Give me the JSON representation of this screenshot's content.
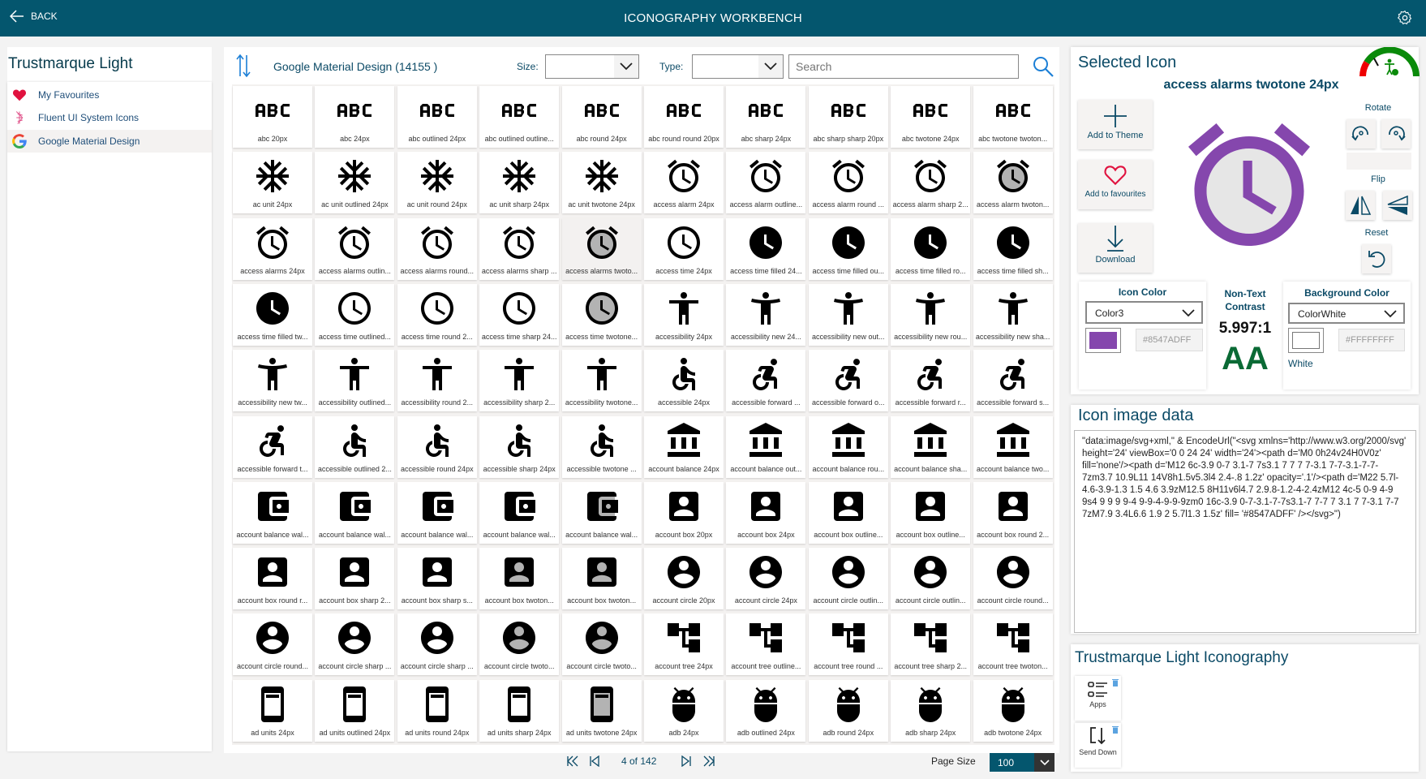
{
  "header": {
    "back_label": "BACK",
    "title": "ICONOGRAPHY WORKBENCH",
    "settings_icon": "gear-icon"
  },
  "left": {
    "title": "Trustmarque Light",
    "libraries": [
      {
        "label": "My Favourites",
        "icon": "heart-icon"
      },
      {
        "label": "Fluent UI System Icons",
        "icon": "fluent-logo-icon"
      },
      {
        "label": "Google Material Design",
        "icon": "google-logo-icon",
        "selected": true
      }
    ]
  },
  "toolbar": {
    "library_title": "Google Material Design (14155 )",
    "size_label": "Size:",
    "size_value": "",
    "type_label": "Type:",
    "type_value": "",
    "search_placeholder": "Search"
  },
  "tiles": [
    {
      "label": "abc  20px",
      "icon": "abc"
    },
    {
      "label": "abc  24px",
      "icon": "abc"
    },
    {
      "label": "abc outlined 24px",
      "icon": "abc"
    },
    {
      "label": "abc outlined outline...",
      "icon": "abc"
    },
    {
      "label": "abc round 24px",
      "icon": "abc"
    },
    {
      "label": "abc round round 20px",
      "icon": "abc"
    },
    {
      "label": "abc sharp 24px",
      "icon": "abc"
    },
    {
      "label": "abc sharp sharp 20px",
      "icon": "abc"
    },
    {
      "label": "abc twotone 24px",
      "icon": "abc"
    },
    {
      "label": "abc twotone twoton...",
      "icon": "abc"
    },
    {
      "label": "ac unit  24px",
      "icon": "acunit"
    },
    {
      "label": "ac unit outlined 24px",
      "icon": "acunit"
    },
    {
      "label": "ac unit round 24px",
      "icon": "acunit"
    },
    {
      "label": "ac unit sharp 24px",
      "icon": "acunit"
    },
    {
      "label": "ac unit twotone 24px",
      "icon": "acunit"
    },
    {
      "label": "access alarm  24px",
      "icon": "alarm"
    },
    {
      "label": "access alarm outline...",
      "icon": "alarm"
    },
    {
      "label": "access alarm round ...",
      "icon": "alarm"
    },
    {
      "label": "access alarm sharp 2...",
      "icon": "alarm"
    },
    {
      "label": "access alarm twoton...",
      "icon": "alarm",
      "twotone": true
    },
    {
      "label": "access alarms  24px",
      "icon": "alarm"
    },
    {
      "label": "access alarms outlin...",
      "icon": "alarm"
    },
    {
      "label": "access alarms round...",
      "icon": "alarm"
    },
    {
      "label": "access alarms sharp ...",
      "icon": "alarm"
    },
    {
      "label": "access alarms twoto...",
      "icon": "alarm",
      "twotone": true,
      "selected": true
    },
    {
      "label": "access time  24px",
      "icon": "time"
    },
    {
      "label": "access time filled  24...",
      "icon": "timefilled"
    },
    {
      "label": "access time filled ou...",
      "icon": "timefilled"
    },
    {
      "label": "access time filled ro...",
      "icon": "timefilled"
    },
    {
      "label": "access time filled sh...",
      "icon": "timefilled"
    },
    {
      "label": "access time filled tw...",
      "icon": "timefilled"
    },
    {
      "label": "access time outlined...",
      "icon": "time"
    },
    {
      "label": "access time round 2...",
      "icon": "time"
    },
    {
      "label": "access time sharp 24...",
      "icon": "time"
    },
    {
      "label": "access time twotone...",
      "icon": "time",
      "twotone": true
    },
    {
      "label": "accessibility  24px",
      "icon": "accessibility"
    },
    {
      "label": "accessibility new  24...",
      "icon": "accessnew"
    },
    {
      "label": "accessibility new out...",
      "icon": "accessnew"
    },
    {
      "label": "accessibility new rou...",
      "icon": "accessnew"
    },
    {
      "label": "accessibility new sha...",
      "icon": "accessnew"
    },
    {
      "label": "accessibility new tw...",
      "icon": "accessnew"
    },
    {
      "label": "accessibility outlined...",
      "icon": "accessibility"
    },
    {
      "label": "accessibility round 2...",
      "icon": "accessibility"
    },
    {
      "label": "accessibility sharp 2...",
      "icon": "accessibility"
    },
    {
      "label": "accessibility twotone...",
      "icon": "accessibility"
    },
    {
      "label": "accessible  24px",
      "icon": "accessible"
    },
    {
      "label": "accessible forward  ...",
      "icon": "accforward"
    },
    {
      "label": "accessible forward o...",
      "icon": "accforward"
    },
    {
      "label": "accessible forward r...",
      "icon": "accforward"
    },
    {
      "label": "accessible forward s...",
      "icon": "accforward"
    },
    {
      "label": "accessible forward t...",
      "icon": "accforward"
    },
    {
      "label": "accessible outlined 2...",
      "icon": "accessible"
    },
    {
      "label": "accessible round 24px",
      "icon": "accessible"
    },
    {
      "label": "accessible sharp 24px",
      "icon": "accessible"
    },
    {
      "label": "accessible twotone ...",
      "icon": "accessible"
    },
    {
      "label": "account balance  24px",
      "icon": "balance"
    },
    {
      "label": "account balance out...",
      "icon": "balance"
    },
    {
      "label": "account balance rou...",
      "icon": "balance"
    },
    {
      "label": "account balance sha...",
      "icon": "balance"
    },
    {
      "label": "account balance two...",
      "icon": "balance",
      "twotone": true
    },
    {
      "label": "account balance wal...",
      "icon": "wallet"
    },
    {
      "label": "account balance wal...",
      "icon": "wallet"
    },
    {
      "label": "account balance wal...",
      "icon": "wallet"
    },
    {
      "label": "account balance wal...",
      "icon": "wallet"
    },
    {
      "label": "account balance wal...",
      "icon": "wallet",
      "twotone": true
    },
    {
      "label": "account box  20px",
      "icon": "box"
    },
    {
      "label": "account box  24px",
      "icon": "box"
    },
    {
      "label": "account box outline...",
      "icon": "box"
    },
    {
      "label": "account box outline...",
      "icon": "box"
    },
    {
      "label": "account box round 2...",
      "icon": "box"
    },
    {
      "label": "account box round r...",
      "icon": "box"
    },
    {
      "label": "account box sharp 2...",
      "icon": "box"
    },
    {
      "label": "account box sharp s...",
      "icon": "box"
    },
    {
      "label": "account box twoton...",
      "icon": "box",
      "twotone": true
    },
    {
      "label": "account box twoton...",
      "icon": "box",
      "twotone": true
    },
    {
      "label": "account circle  20px",
      "icon": "circle"
    },
    {
      "label": "account circle  24px",
      "icon": "circle"
    },
    {
      "label": "account circle outlin...",
      "icon": "circle"
    },
    {
      "label": "account circle outlin...",
      "icon": "circle"
    },
    {
      "label": "account circle round...",
      "icon": "circle"
    },
    {
      "label": "account circle round...",
      "icon": "circle"
    },
    {
      "label": "account circle sharp ...",
      "icon": "circle"
    },
    {
      "label": "account circle sharp ...",
      "icon": "circle"
    },
    {
      "label": "account circle twoto...",
      "icon": "circle",
      "twotone": true
    },
    {
      "label": "account circle twoto...",
      "icon": "circle",
      "twotone": true
    },
    {
      "label": "account tree  24px",
      "icon": "tree"
    },
    {
      "label": "account tree outline...",
      "icon": "tree"
    },
    {
      "label": "account tree round ...",
      "icon": "tree"
    },
    {
      "label": "account tree sharp 2...",
      "icon": "tree"
    },
    {
      "label": "account tree twoton...",
      "icon": "tree",
      "twotone": true
    },
    {
      "label": "ad units  24px",
      "icon": "adunits"
    },
    {
      "label": "ad units outlined 24px",
      "icon": "adunits"
    },
    {
      "label": "ad units round 24px",
      "icon": "adunits"
    },
    {
      "label": "ad units sharp 24px",
      "icon": "adunits"
    },
    {
      "label": "ad units twotone 24px",
      "icon": "adunits",
      "twotone": true
    },
    {
      "label": "adb  24px",
      "icon": "adb"
    },
    {
      "label": "adb outlined 24px",
      "icon": "adb"
    },
    {
      "label": "adb round 24px",
      "icon": "adb"
    },
    {
      "label": "adb sharp 24px",
      "icon": "adb"
    },
    {
      "label": "adb twotone 24px",
      "icon": "adb"
    }
  ],
  "pagination": {
    "page_text": "4 of 142",
    "page_size_label": "Page Size",
    "page_size_value": "100"
  },
  "selected": {
    "title": "Selected Icon",
    "name": "access alarms twotone 24px",
    "add_theme_label": "Add to Theme",
    "add_fav_label": "Add to favourites",
    "download_label": "Download",
    "rotate_label": "Rotate",
    "flip_label": "Flip",
    "reset_label": "Reset",
    "icon_color_label": "Icon Color",
    "icon_color_value": "Color3",
    "icon_color_hex": "#8547ADFF",
    "contrast_label_1": "Non-Text",
    "contrast_label_2": "Contrast",
    "contrast_ratio": "5.997:1",
    "contrast_rating": "AA",
    "bg_color_label": "Background Color",
    "bg_color_value": "ColorWhite",
    "bg_color_hex": "#FFFFFFFF",
    "bg_color_name": "White"
  },
  "image_data": {
    "title": "Icon image data",
    "code": "\"data:image/svg+xml,\" & EncodeUrl(\"<svg xmlns='http://www.w3.org/2000/svg' height='24' viewBox='0 0 24 24' width='24'><path  d='M0 0h24v24H0V0z' fill='none'/><path  d='M12 6c-3.9 0-7 3.1-7 7s3.1 7 7 7 7-3.1 7-7-3.1-7-7-7zm3.7 10.9L11 14V8h1.5v5.3l4 2.4-.8 1.2z' opacity='.1'/><path  d='M22 5.7l-4.6-3.9-1.3 1.5 4.6 3.9zM12.5 8H11v6l4.7 2.9.8-1.2-4-2.4zM12 4c-5 0-9 4-9 9s4 9 9 9 9-4 9-9-4-9-9-9zm0 16c-3.9 0-7-3.1-7-7s3.1-7 7-7 7 3.1 7 7-3.1 7-7 7zM7.9 3.4L6.6 1.9 2 5.7l1.3 1.5z' fill= '#8547ADFF' /></svg>\")"
  },
  "theme": {
    "title": "Trustmarque Light Iconography",
    "items": [
      {
        "label": "Apps"
      },
      {
        "label": "Send Down"
      }
    ]
  },
  "colors": {
    "header": "#04566e",
    "icon_color": "#8547AD",
    "accent_text": "#0b4a66",
    "aa_green": "#0a6a35"
  }
}
